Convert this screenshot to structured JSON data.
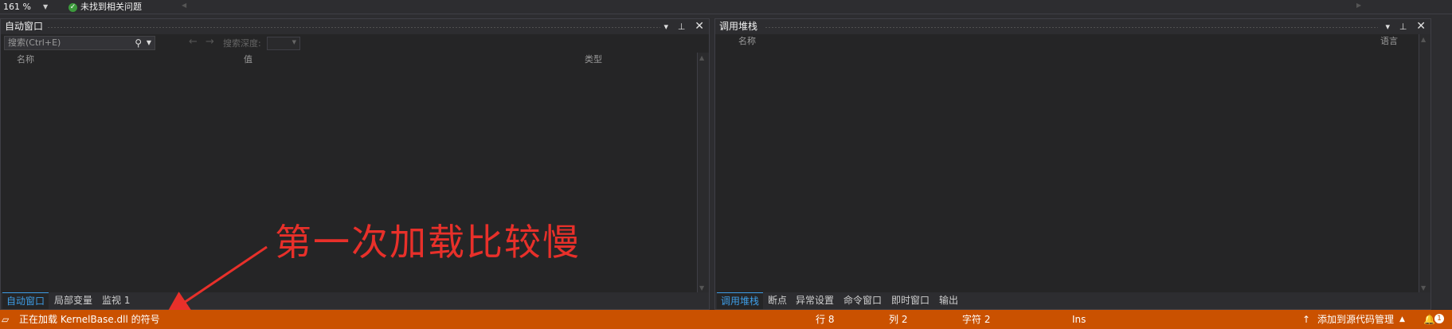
{
  "topbar": {
    "zoom": "161 %",
    "issue_status": "未找到相关问题"
  },
  "autos": {
    "title": "自动窗口",
    "search_placeholder": "搜索(Ctrl+E)",
    "depth_label": "搜索深度:",
    "columns": [
      "名称",
      "值",
      "类型"
    ],
    "tabs": [
      "自动窗口",
      "局部变量",
      "监视 1"
    ]
  },
  "callstack": {
    "title": "调用堆栈",
    "columns": [
      "名称",
      "语言"
    ],
    "tabs": [
      "调用堆栈",
      "断点",
      "异常设置",
      "命令窗口",
      "即时窗口",
      "输出"
    ]
  },
  "annotation": {
    "text": "第一次加载比较慢",
    "color": "#e8302a"
  },
  "statusbar": {
    "message": "正在加载 KernelBase.dll 的符号",
    "line": "行 8",
    "col": "列 2",
    "char": "字符 2",
    "mode": "Ins",
    "source_control": "添加到源代码管理",
    "notification_count": "1",
    "color": "#ca5100"
  },
  "accent": "#3e9de5"
}
